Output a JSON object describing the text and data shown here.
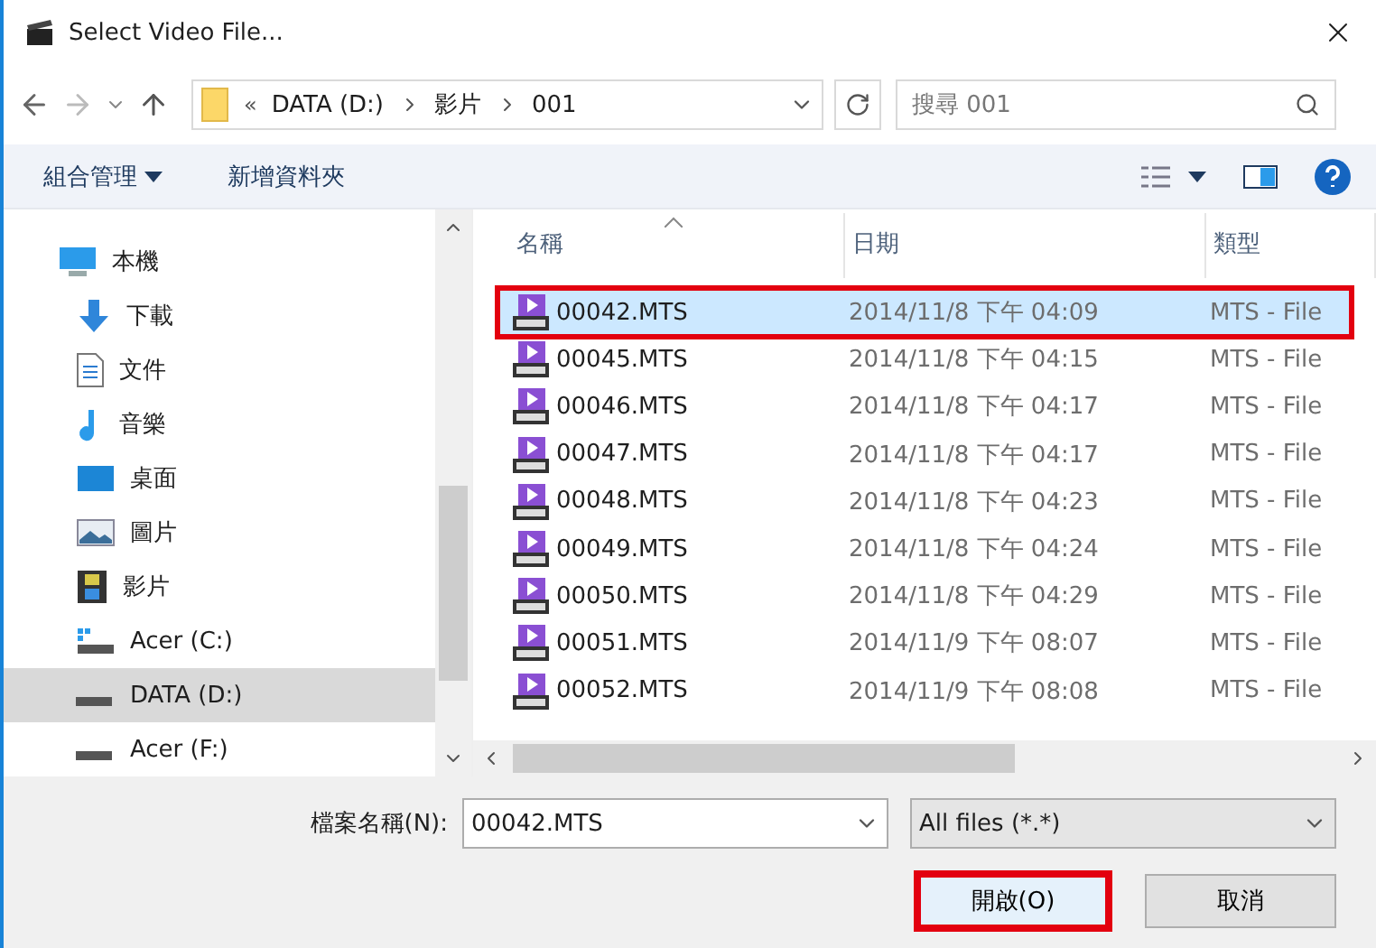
{
  "window": {
    "title": "Select Video File..."
  },
  "address": {
    "crumbs": [
      "DATA (D:)",
      "影片",
      "001"
    ],
    "overflow": "«"
  },
  "search": {
    "placeholder": "搜尋 001"
  },
  "toolbar": {
    "organize": "組合管理",
    "new_folder": "新增資料夾"
  },
  "sidebar": {
    "items": [
      {
        "label": "本機",
        "kind": "pc",
        "selected": false
      },
      {
        "label": "下載",
        "kind": "download",
        "selected": false
      },
      {
        "label": "文件",
        "kind": "document",
        "selected": false
      },
      {
        "label": "音樂",
        "kind": "music",
        "selected": false
      },
      {
        "label": "桌面",
        "kind": "desktop",
        "selected": false
      },
      {
        "label": "圖片",
        "kind": "pictures",
        "selected": false
      },
      {
        "label": "影片",
        "kind": "videos",
        "selected": false
      },
      {
        "label": "Acer (C:)",
        "kind": "system",
        "selected": false
      },
      {
        "label": "DATA (D:)",
        "kind": "drive",
        "selected": true
      },
      {
        "label": "Acer (F:)",
        "kind": "drive",
        "selected": false
      }
    ]
  },
  "table": {
    "columns": [
      "名稱",
      "日期",
      "類型"
    ],
    "rows": [
      {
        "name": "00042.MTS",
        "date": "2014/11/8 下午 04:09",
        "type": "MTS - File",
        "selected": true,
        "annotated": true
      },
      {
        "name": "00045.MTS",
        "date": "2014/11/8 下午 04:15",
        "type": "MTS - File",
        "selected": false,
        "annotated": false
      },
      {
        "name": "00046.MTS",
        "date": "2014/11/8 下午 04:17",
        "type": "MTS - File",
        "selected": false,
        "annotated": false
      },
      {
        "name": "00047.MTS",
        "date": "2014/11/8 下午 04:17",
        "type": "MTS - File",
        "selected": false,
        "annotated": false
      },
      {
        "name": "00048.MTS",
        "date": "2014/11/8 下午 04:23",
        "type": "MTS - File",
        "selected": false,
        "annotated": false
      },
      {
        "name": "00049.MTS",
        "date": "2014/11/8 下午 04:24",
        "type": "MTS - File",
        "selected": false,
        "annotated": false
      },
      {
        "name": "00050.MTS",
        "date": "2014/11/8 下午 04:29",
        "type": "MTS - File",
        "selected": false,
        "annotated": false
      },
      {
        "name": "00051.MTS",
        "date": "2014/11/9 下午 08:07",
        "type": "MTS - File",
        "selected": false,
        "annotated": false
      },
      {
        "name": "00052.MTS",
        "date": "2014/11/9 下午 08:08",
        "type": "MTS - File",
        "selected": false,
        "annotated": false
      }
    ]
  },
  "footer": {
    "filename_label": "檔案名稱(N):",
    "filename": "00042.MTS",
    "filter": "All files (*.*)",
    "open": {
      "label": "開啟(O)",
      "annotated": true
    },
    "cancel": "取消"
  }
}
